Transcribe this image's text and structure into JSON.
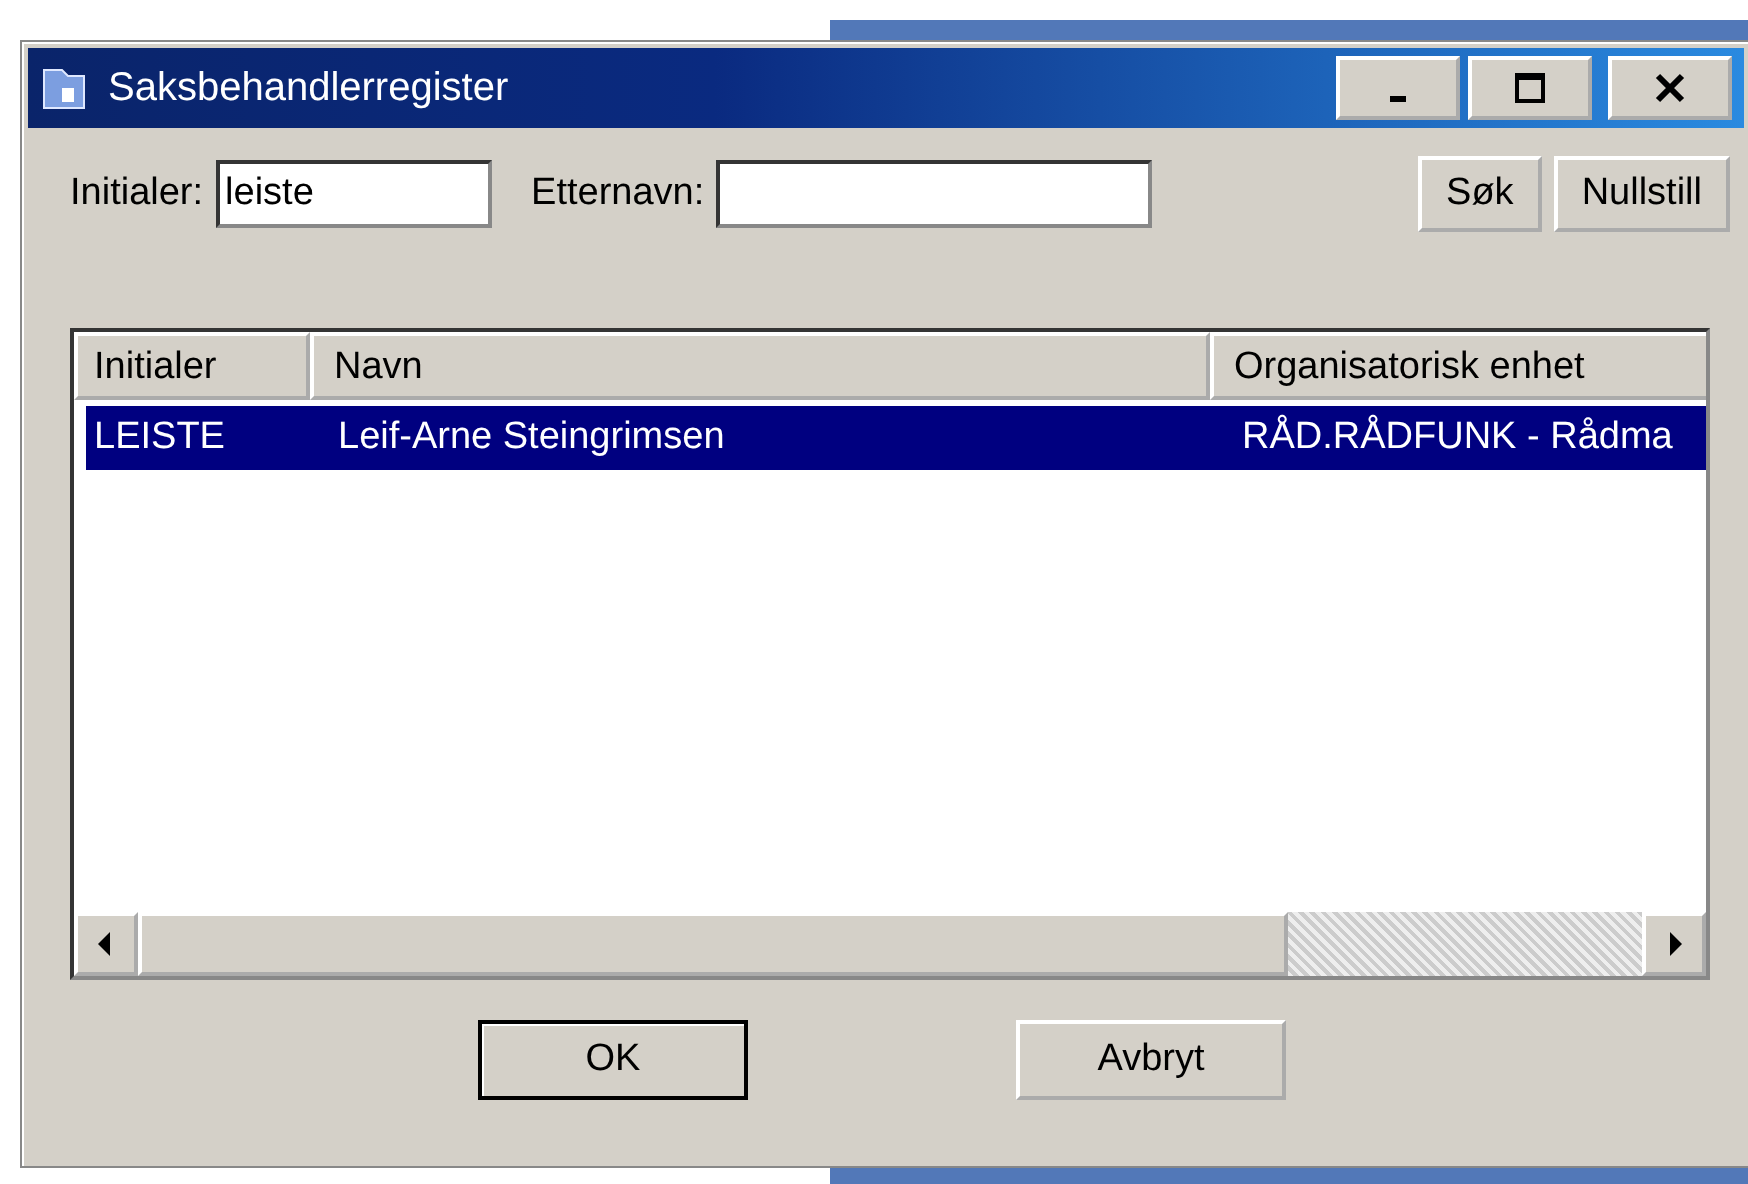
{
  "window": {
    "title": "Saksbehandlerregister"
  },
  "filters": [
    {
      "label": "Initialer:",
      "value": "leiste",
      "kind": "short"
    },
    {
      "label": "Etternavn:",
      "kind": "long"
    }
  ],
  "search_buttons": [
    "Søk",
    "Nullstill"
  ],
  "table": {
    "columns": [
      "Initialer",
      "Navn",
      "Organisatorisk enhet"
    ],
    "rows": [
      {
        "cells": [
          "LEISTE",
          "Leif-Arne Steingrimsen",
          "RÅD.RÅDFUNK - Rådma"
        ],
        "selected": true
      }
    ]
  },
  "buttons": [
    "OK",
    "Avbryt"
  ]
}
